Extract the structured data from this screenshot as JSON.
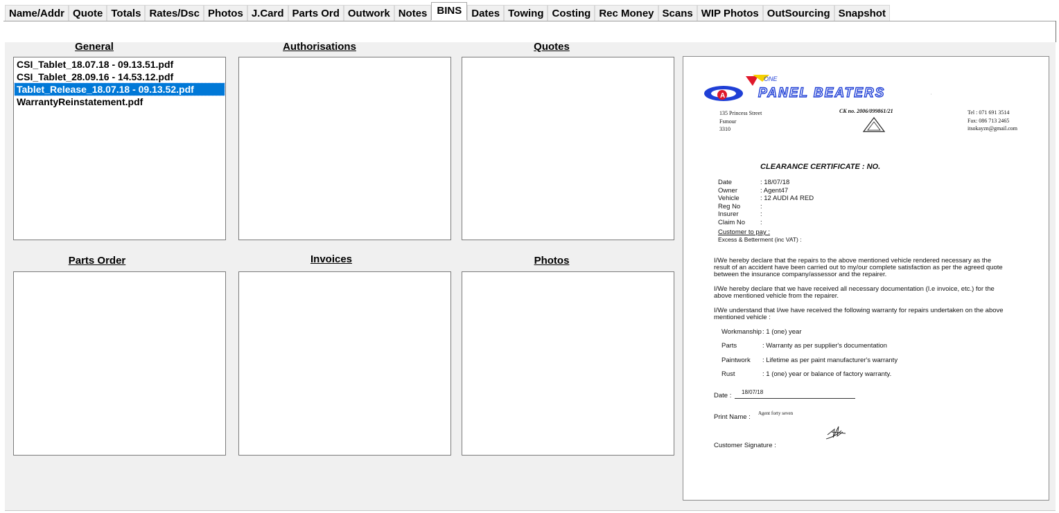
{
  "tabs": [
    {
      "label": "Name/Addr",
      "active": false
    },
    {
      "label": "Quote",
      "active": false
    },
    {
      "label": "Totals",
      "active": false
    },
    {
      "label": "Rates/Dsc",
      "active": false
    },
    {
      "label": "Photos",
      "active": false
    },
    {
      "label": "J.Card",
      "active": false
    },
    {
      "label": "Parts Ord",
      "active": false
    },
    {
      "label": "Outwork",
      "active": false
    },
    {
      "label": "Notes",
      "active": false
    },
    {
      "label": "BINS",
      "active": true
    },
    {
      "label": "Dates",
      "active": false
    },
    {
      "label": "Towing",
      "active": false
    },
    {
      "label": "Costing",
      "active": false
    },
    {
      "label": "Rec Money",
      "active": false
    },
    {
      "label": "Scans",
      "active": false
    },
    {
      "label": "WIP Photos",
      "active": false
    },
    {
      "label": "OutSourcing",
      "active": false
    },
    {
      "label": "Snapshot",
      "active": false
    }
  ],
  "bins": {
    "general": {
      "title": "General",
      "files": [
        {
          "name": "CSI_Tablet_18.07.18 - 09.13.51.pdf",
          "selected": false
        },
        {
          "name": "CSI_Tablet_28.09.16 - 14.53.12.pdf",
          "selected": false
        },
        {
          "name": "Tablet_Release_18.07.18 - 09.13.52.pdf",
          "selected": true
        },
        {
          "name": "WarrantyReinstatement.pdf",
          "selected": false
        }
      ]
    },
    "authorisations": {
      "title": "Authorisations",
      "files": []
    },
    "quotes": {
      "title": "Quotes",
      "files": []
    },
    "parts_order": {
      "title": "Parts Order",
      "files": []
    },
    "invoices": {
      "title": "Invoices",
      "files": []
    },
    "photos": {
      "title": "Photos",
      "files": []
    }
  },
  "preview": {
    "logo_text": "PANEL BEATERS",
    "address": [
      "135 Princess Street",
      "Fsmour",
      "3310"
    ],
    "ck_no": "CK no. 2006/099861/21",
    "contact": [
      "Tel : 071 691 3514",
      "Fax: 086 713 2465",
      "itsokayzn@gmail.com"
    ],
    "doc_title": "CLEARANCE CERTIFICATE : NO.",
    "fields": [
      {
        "label": "Date",
        "value": ":  18/07/18"
      },
      {
        "label": "Owner",
        "value": ":  Agent47"
      },
      {
        "label": "Vehicle",
        "value": ":  12 AUDI A4 RED"
      },
      {
        "label": "Reg No",
        "value": ":"
      },
      {
        "label": "Insurer",
        "value": ":"
      },
      {
        "label": "Claim No",
        "value": ":"
      }
    ],
    "customer_to_pay": "Customer to pay :",
    "excess": "Excess & Betterment (inc VAT) :",
    "para1": [
      "I/We hereby declare that the repairs to the above mentioned vehicle rendered necessary as the",
      "result of an accident have been carried out to my/our complete satisfaction as per the agreed quote",
      "between the insurance company/assessor and the repairer."
    ],
    "para2": [
      "I/We hereby declare that we have received all necessary documentation (I.e invoice, etc.) for the",
      "above mentioned vehicle from the repairer."
    ],
    "para3": [
      "I/We understand that I/we have received the following warranty for repairs undertaken on the above",
      "mentioned vehicle :"
    ],
    "warranty": [
      {
        "label": "Workmanship",
        "value": ": 1 (one) year"
      },
      {
        "label": "Parts",
        "value": ": Warranty as per supplier's documentation"
      },
      {
        "label": "Paintwork",
        "value": ": Lifetime as per paint manufacturer's warranty"
      },
      {
        "label": "Rust",
        "value": ": 1 (one) year or balance of factory warranty."
      }
    ],
    "date_label": "Date :",
    "date_value": "18/07/18",
    "print_name_label": "Print Name :",
    "print_name_value": "Agent forty seven",
    "signature_label": "Customer Signature :"
  }
}
